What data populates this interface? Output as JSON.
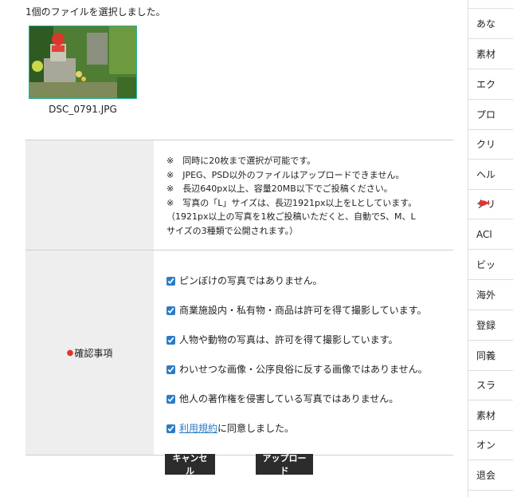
{
  "selection_message": "1個のファイルを選択しました。",
  "file": {
    "name": "DSC_0791.JPG"
  },
  "notes": [
    "※　同時に20枚まで選択が可能です。",
    "※　JPEG、PSD以外のファイルはアップロードできません。",
    "※　長辺640px以上、容量20MB以下でご投稿ください。",
    "※　写真の「L」サイズは、長辺1921px以上をLとしています。"
  ],
  "note_extra_1": "（1921px以上の写真を1枚ご投稿いただくと、自動でS、M、L",
  "note_extra_2": "サイズの3種類で公開されます。）",
  "confirm": {
    "label": "確認事項",
    "required_mark": "●",
    "items": [
      "ピンぼけの写真ではありません。",
      "商業施設内・私有物・商品は許可を得て撮影しています。",
      "人物や動物の写真は、許可を得て撮影しています。",
      "わいせつな画像・公序良俗に反する画像ではありません。",
      "他人の著作権を侵害している写真ではありません。"
    ],
    "terms_link": "利用規約",
    "terms_suffix": "に同意しました。"
  },
  "buttons": {
    "cancel": "キャンセル",
    "upload": "アップロード"
  },
  "sidebar": {
    "items": [
      "あな",
      "素材",
      "エク",
      "プロ",
      "クリ",
      "ヘル",
      "クリ",
      "ACl",
      "ビッ",
      "海外",
      "登録",
      "同義",
      "スラ",
      "素材",
      "オン",
      "退会"
    ],
    "active_index": 6
  },
  "colors": {
    "accent_link": "#2a7cc7",
    "required": "#e8312c",
    "button_bg": "#2c2c2c",
    "thumb_border": "#21b3a3"
  }
}
